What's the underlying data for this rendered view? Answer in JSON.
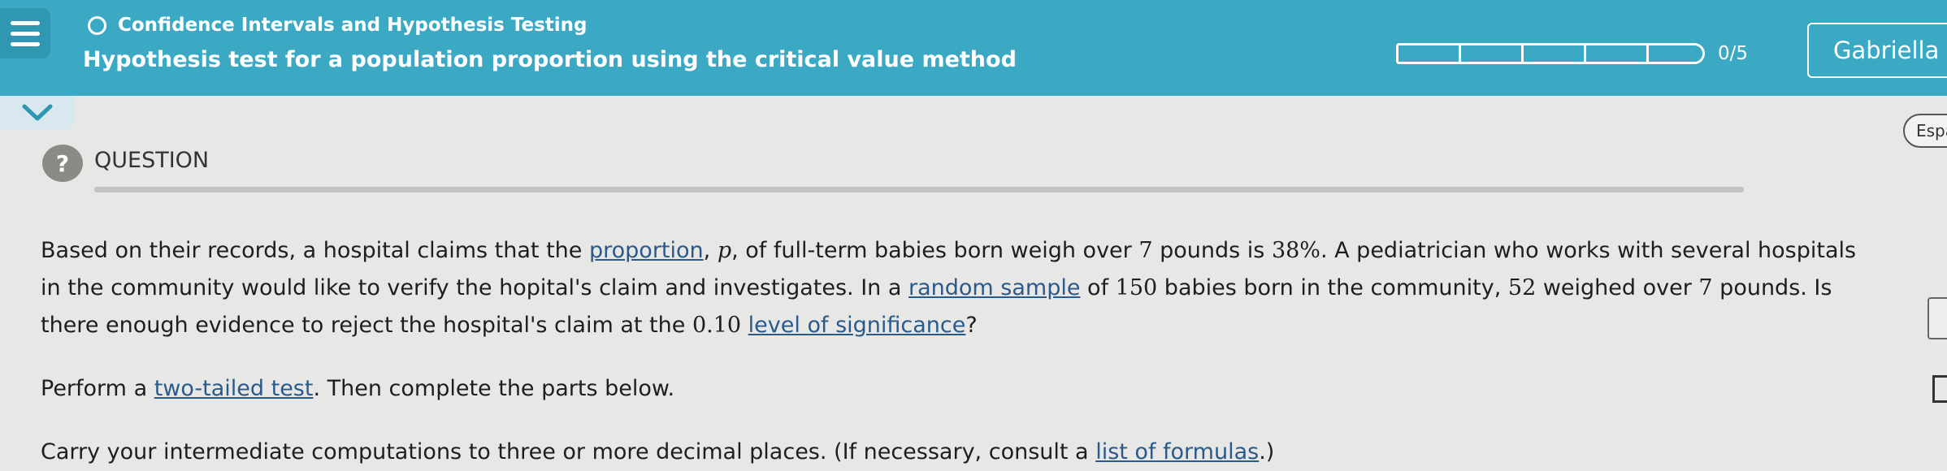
{
  "header": {
    "topic": "Confidence Intervals and Hypothesis Testing",
    "title": "Hypothesis test for a population proportion using the critical value method",
    "progress_text": "0/5",
    "progress_fraction": 0.0,
    "user_name": "Gabriella"
  },
  "lang_button": "Espa",
  "question": {
    "icon": "?",
    "label": "QUESTION",
    "line1_a": "Based on their records, a hospital claims that the ",
    "link_proportion": "proportion",
    "line1_b": ", ",
    "p_symbol": "p",
    "line1_c": ", of full-term babies born weigh over ",
    "num7a": "7",
    "line1_d": " pounds is ",
    "percent": "38%",
    "line1_e": ". A pediatrician who works with several hospitals in the community would like to verify the hopital's claim and investigates. In a ",
    "link_random_sample": "random sample",
    "line2_a": " of ",
    "num150": "150",
    "line2_b": " babies born in the community, ",
    "num52": "52",
    "line2_c": " weighed over ",
    "num7b": "7",
    "line3_a": " pounds. Is there enough evidence to reject the hospital's claim at the ",
    "num010": "0.10",
    "line3_b": " ",
    "link_level": "level of significance",
    "line3_c": "?",
    "para2_a": "Perform a ",
    "link_two_tailed": "two-tailed test",
    "para2_b": ". Then complete the parts below.",
    "para3_a": "Carry your intermediate computations to three or more decimal places. (If necessary, consult a ",
    "link_formulas": "list of formulas",
    "para3_b": ".)"
  },
  "colors": {
    "header_bg": "#3ba9c4",
    "page_bg": "#e7e7e5",
    "link": "#2a5a8c"
  }
}
